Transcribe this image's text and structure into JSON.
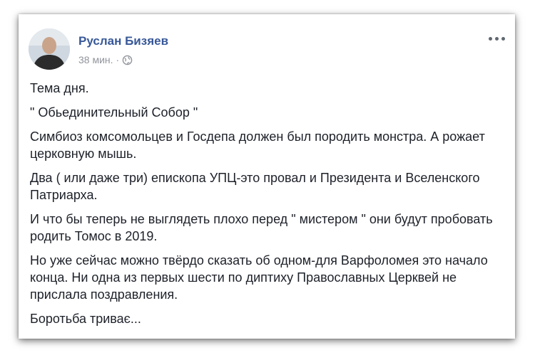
{
  "post": {
    "author": "Руслан Бизяев",
    "time": "38 мин.",
    "dot": "·",
    "privacy_icon": "globe-icon",
    "more_icon": "more-options-icon",
    "paragraphs": [
      "Тема дня.",
      "\" Обьединительный Собор \"",
      "Симбиоз комсомольцев и Госдепа должен был породить монстра. А рожает церковную мышь.",
      "Два ( или даже три) епископа УПЦ-это провал и Президента и Вселенского Патриарха.",
      "И что бы теперь не выглядеть плохо перед \" мистером \" они будут пробовать родить Томос в 2019.",
      "Но уже сейчас можно твёрдо сказать об одном-для Варфоломея это начало конца. Ни одна из первых шести по диптиху Православных Церквей не прислала поздравления.",
      "Боротьба триває..."
    ]
  },
  "colors": {
    "author": "#385898",
    "meta": "#90949c",
    "text": "#1d2129"
  }
}
